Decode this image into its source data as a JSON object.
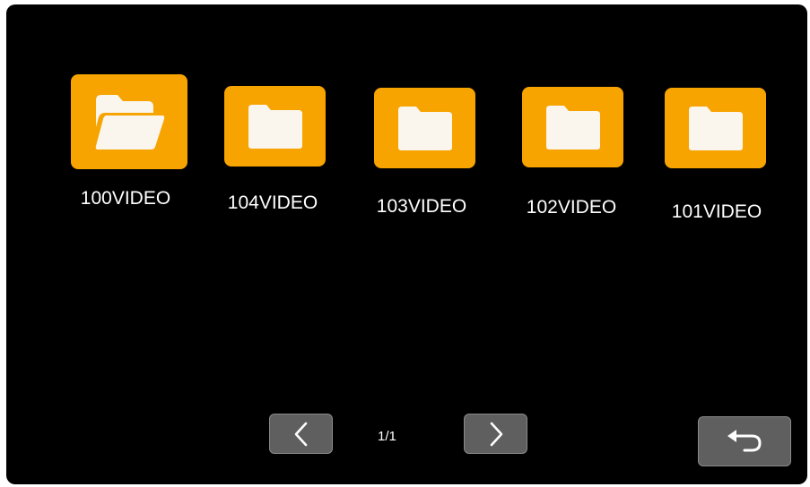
{
  "folders": [
    {
      "name": "100VIDEO",
      "state": "open",
      "icon": "folder-open-icon"
    },
    {
      "name": "104VIDEO",
      "state": "closed",
      "icon": "folder-icon"
    },
    {
      "name": "103VIDEO",
      "state": "closed",
      "icon": "folder-icon"
    },
    {
      "name": "102VIDEO",
      "state": "closed",
      "icon": "folder-icon"
    },
    {
      "name": "101VIDEO",
      "state": "closed",
      "icon": "folder-icon"
    }
  ],
  "pagination": {
    "indicator": "1/1",
    "prev_icon": "chevron-left-icon",
    "next_icon": "chevron-right-icon"
  },
  "back": {
    "icon": "return-arrow-icon"
  },
  "colors": {
    "accent": "#F7A300",
    "folder_glyph": "#FAF6EE",
    "background": "#000000",
    "button": "#5F5F5F"
  }
}
